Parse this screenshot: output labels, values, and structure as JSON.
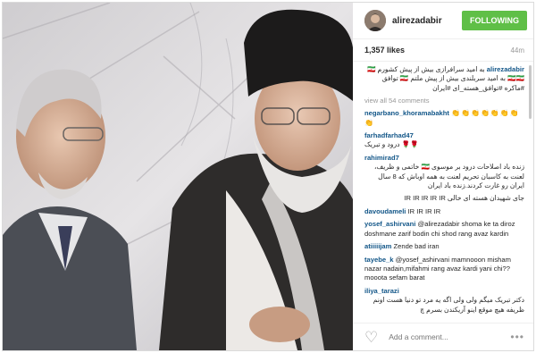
{
  "post": {
    "username": "alirezadabir",
    "follow_label": "FOLLOWING",
    "likes": "1,357 likes",
    "time": "44m"
  },
  "comments": [
    {
      "user": "alirezadabir",
      "text": "به امید سرافرازی بیش از پیش کشورم 🇮🇷🇮🇷🇮🇷 به امید سربلندی بیش از پیش ملتم 🇮🇷 توافق #ماکره #توافق_هسته_ای #ایران",
      "rtl": true
    },
    {
      "view_all": "view all 54 comments"
    },
    {
      "user": "negarbano_khoramabakht",
      "text": "👏👏👏👏👏👏👏👏",
      "emoji": true
    },
    {
      "user": "farhadfarhad47",
      "text": "درود و تبریک 🌹🌹",
      "rtl": false
    },
    {
      "user": "rahimirad7",
      "text": "زنده باد اصلاحات درود بر موسوی 🇮🇷 خاتمی و ظریف، لعنت به کاسبان تحریم لعنت به همه اوباش که 8 سال ایران رو غارت کردند.زنده باد ایران",
      "rtl": true
    },
    {
      "user": "",
      "text": "جای شهیدان هسته ای خالی IR IR IR IR IR",
      "rtl": true
    },
    {
      "user": "davoudameli",
      "text": "IR IR IR IR",
      "rtl": false
    },
    {
      "user": "yosef_ashirvani",
      "text": "@alirezadabir shoma ke ta diroz doshmane zarif bodin chi shod rang avaz kardin",
      "rtl": false
    },
    {
      "user": "atiiiiijam",
      "text": "Zende bad iran",
      "rtl": false
    },
    {
      "user": "tayebe_k",
      "text": "@yosef_ashirvani mamnooon misham nazar nadain,mifahmi rang avaz kardi yani chi??mooota sefam barat",
      "rtl": false
    },
    {
      "user": "iliya_tarazi",
      "text": "دکتر تبریک میگم ولی ولی اگه یه مرد تو دنیا هست اونم ظریفه هیچ موقع اینو آریکندن بسرم چ",
      "rtl": true
    }
  ],
  "footer": {
    "add_comment_placeholder": "Add a comment...",
    "more_label": "•••"
  }
}
